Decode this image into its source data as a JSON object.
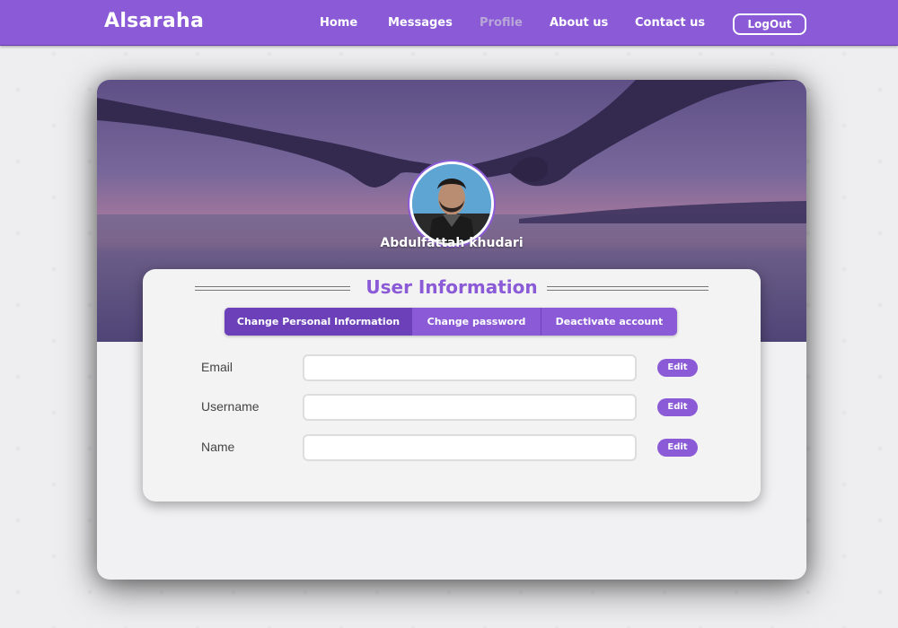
{
  "navbar": {
    "brand": "Alsaraha",
    "links": [
      {
        "label": "Home",
        "active": false
      },
      {
        "label": "Messages",
        "active": false
      },
      {
        "label": "Profile",
        "active": true
      },
      {
        "label": "About us",
        "active": false
      },
      {
        "label": "Contact us",
        "active": false
      }
    ],
    "logout_label": "LogOut"
  },
  "profile": {
    "name": "Abdulfattah khudari"
  },
  "panel": {
    "title": "User Information",
    "tabs": [
      {
        "label": "Change Personal Information",
        "active": true
      },
      {
        "label": "Change password",
        "active": false
      },
      {
        "label": "Deactivate account",
        "active": false
      }
    ],
    "fields": [
      {
        "label": "Email",
        "value": "",
        "edit_label": "Edit"
      },
      {
        "label": "Username",
        "value": "",
        "edit_label": "Edit"
      },
      {
        "label": "Name",
        "value": "",
        "edit_label": "Edit"
      }
    ]
  },
  "colors": {
    "accent": "#8b5ad6",
    "accent_dark": "#6b40b8",
    "inactive_nav": "#b9a7d8",
    "page_bg": "#eeeef0"
  },
  "icons": [
    "avatar-photo",
    "cover-photo-holding-hands"
  ]
}
